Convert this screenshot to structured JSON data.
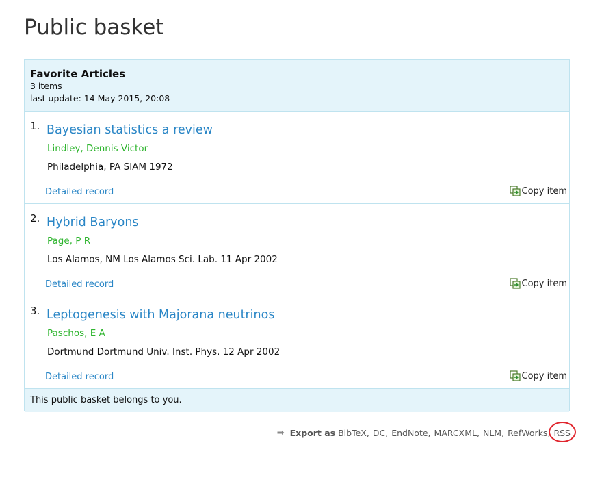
{
  "page": {
    "title": "Public basket"
  },
  "basket": {
    "name": "Favorite Articles",
    "item_count": "3 items",
    "last_update": "last update: 14 May 2015, 20:08",
    "footer": "This public basket belongs to you.",
    "items": [
      {
        "number": "1.",
        "title": "Bayesian statistics a review",
        "author": "Lindley, Dennis Victor",
        "publication": "Philadelphia, PA SIAM 1972",
        "detail_label": "Detailed record",
        "copy_label": "Copy item"
      },
      {
        "number": "2.",
        "title": "Hybrid Baryons",
        "author": "Page, P R",
        "publication": "Los Alamos, NM Los Alamos Sci. Lab. 11 Apr 2002",
        "detail_label": "Detailed record",
        "copy_label": "Copy item"
      },
      {
        "number": "3.",
        "title": "Leptogenesis with Majorana neutrinos",
        "author": "Paschos, E A",
        "publication": "Dortmund Dortmund Univ. Inst. Phys. 12 Apr 2002",
        "detail_label": "Detailed record",
        "copy_label": "Copy item"
      }
    ]
  },
  "export": {
    "label": "Export as",
    "formats": [
      "BibTeX",
      "DC",
      "EndNote",
      "MARCXML",
      "NLM",
      "RefWorks",
      "RSS"
    ],
    "separator": ","
  },
  "icons": {
    "arrow": "right-arrow-icon",
    "copy": "copy-item-icon"
  },
  "colors": {
    "link": "#2a86c6",
    "author": "#2fb52f",
    "panel_bg": "#e4f4fa",
    "panel_border": "#bfe3ef",
    "highlight": "#e0262e"
  }
}
